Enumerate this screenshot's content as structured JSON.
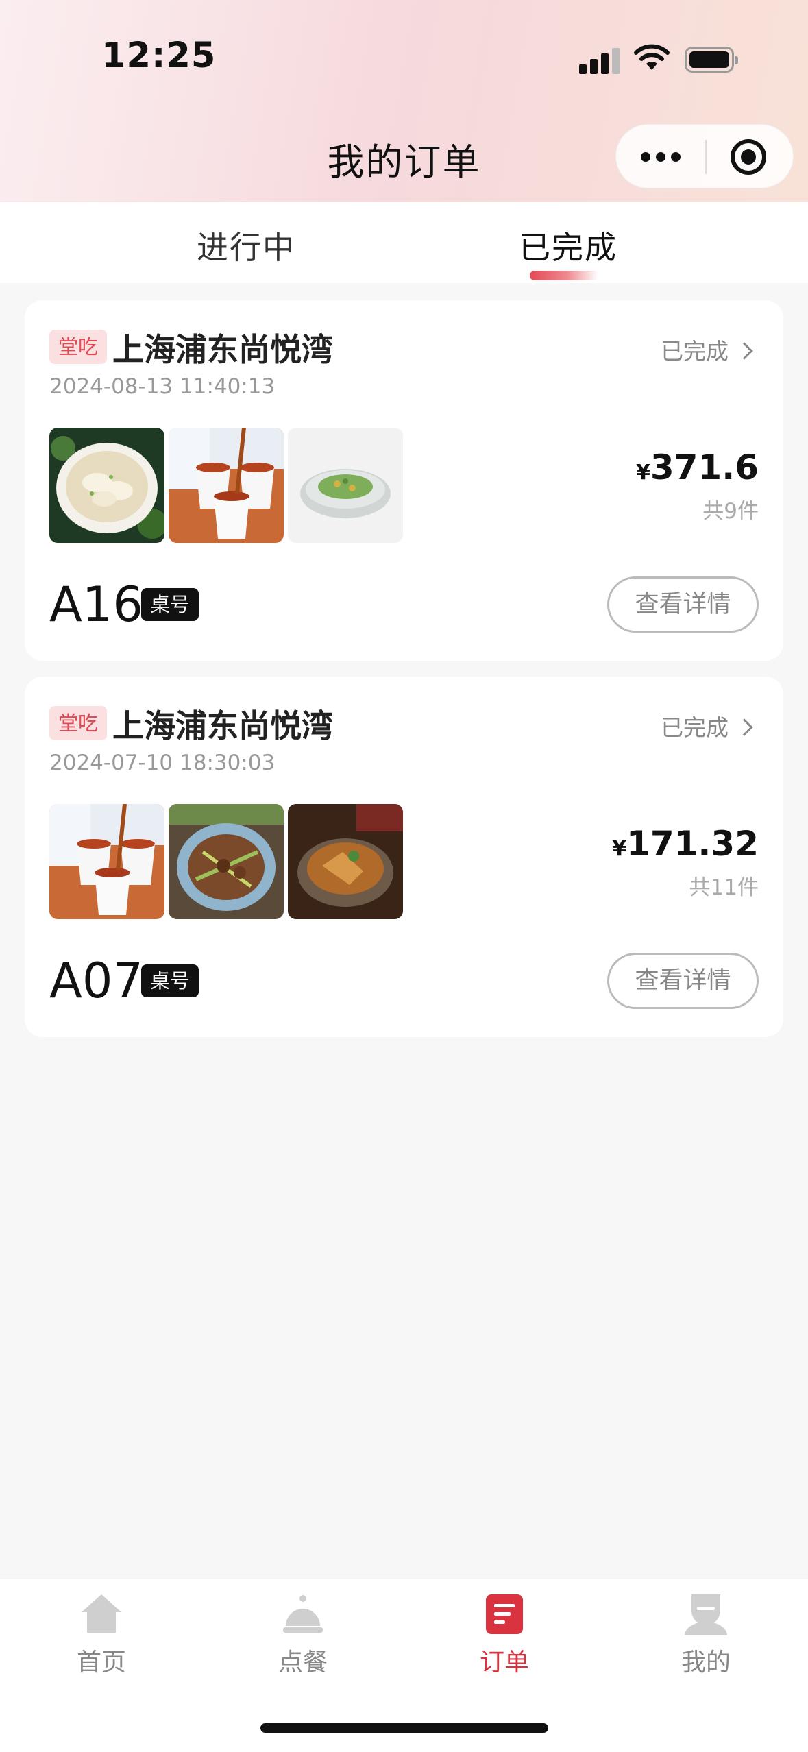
{
  "status_bar": {
    "time": "12:25"
  },
  "header": {
    "title": "我的订单"
  },
  "tabs": [
    {
      "label": "进行中",
      "active": false
    },
    {
      "label": "已完成",
      "active": true
    }
  ],
  "orders": [
    {
      "tag": "堂吃",
      "store": "上海浦东尚悦湾",
      "status": "已完成",
      "time": "2024-08-13 11:40:13",
      "currency": "¥",
      "amount": "371.6",
      "count": "共9件",
      "table_no": "A16",
      "table_label": "桌号",
      "detail_label": "查看详情",
      "thumbs": [
        "dumpling-soup-image",
        "tea-cups-image",
        "vegetable-dish-image"
      ]
    },
    {
      "tag": "堂吃",
      "store": "上海浦东尚悦湾",
      "status": "已完成",
      "time": "2024-07-10 18:30:03",
      "currency": "¥",
      "amount": "171.32",
      "count": "共11件",
      "table_no": "A07",
      "table_label": "桌号",
      "detail_label": "查看详情",
      "thumbs": [
        "tea-cups-image",
        "stir-fry-image",
        "braised-dish-image"
      ]
    }
  ],
  "bottom_nav": [
    {
      "label": "首页",
      "icon": "home-icon",
      "active": false
    },
    {
      "label": "点餐",
      "icon": "service-bell-icon",
      "active": false
    },
    {
      "label": "订单",
      "icon": "order-icon",
      "active": true
    },
    {
      "label": "我的",
      "icon": "profile-icon",
      "active": false
    }
  ],
  "colors": {
    "accent": "#d8333f",
    "tag_bg": "#fbe0e2",
    "page_bg": "#f7f7f7"
  }
}
